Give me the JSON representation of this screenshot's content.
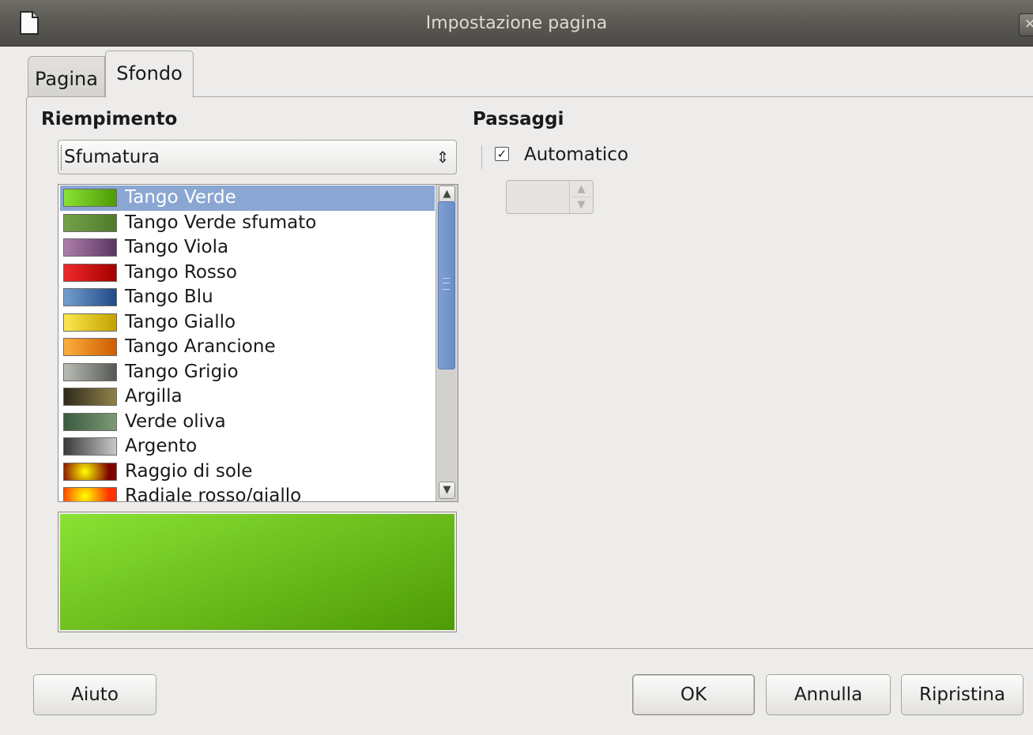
{
  "window": {
    "title": "Impostazione pagina",
    "close_glyph": "✕"
  },
  "tabs": [
    {
      "label": "Pagina",
      "active": false
    },
    {
      "label": "Sfondo",
      "active": true
    }
  ],
  "fill": {
    "heading": "Riempimento",
    "type_value": "Sfumatura",
    "gradients": [
      {
        "label": "Tango Verde",
        "colors": [
          "#8ae234",
          "#4e9a06"
        ],
        "selected": true
      },
      {
        "label": "Tango Verde sfumato",
        "colors": [
          "#73a24a",
          "#4e7b2a"
        ],
        "selected": false
      },
      {
        "label": "Tango Viola",
        "colors": [
          "#ad7fa8",
          "#5c3566"
        ],
        "selected": false
      },
      {
        "label": "Tango Rosso",
        "colors": [
          "#ef2929",
          "#a40000"
        ],
        "selected": false
      },
      {
        "label": "Tango Blu",
        "colors": [
          "#729fcf",
          "#204a87"
        ],
        "selected": false
      },
      {
        "label": "Tango Giallo",
        "colors": [
          "#fce94f",
          "#c4a000"
        ],
        "selected": false
      },
      {
        "label": "Tango Arancione",
        "colors": [
          "#fcaf3e",
          "#ce5c00"
        ],
        "selected": false
      },
      {
        "label": "Tango Grigio",
        "colors": [
          "#babdb6",
          "#555753"
        ],
        "selected": false
      },
      {
        "label": "Argilla",
        "colors": [
          "#2f2a1c",
          "#8f8348"
        ],
        "selected": false
      },
      {
        "label": "Verde oliva",
        "colors": [
          "#3b5a3f",
          "#7c9a74"
        ],
        "selected": false
      },
      {
        "label": "Argento",
        "colors": [
          "#3a3a3a",
          "#c8c8c8"
        ],
        "selected": false
      },
      {
        "label": "Raggio di sole",
        "colors": [
          "#ffff00",
          "#800000"
        ],
        "selected": false
      },
      {
        "label": "Radiale rosso/giallo",
        "colors": [
          "#ffff00",
          "#ff3300"
        ],
        "selected": false
      }
    ],
    "preview_colors": [
      "#8ae234",
      "#4e9a06"
    ]
  },
  "steps": {
    "heading": "Passaggi",
    "automatic_label": "Automatico",
    "automatic_checked": true,
    "check_glyph": "✓",
    "increment_value": ""
  },
  "buttons": {
    "help": "Aiuto",
    "ok": "OK",
    "cancel": "Annulla",
    "reset": "Ripristina"
  },
  "glyphs": {
    "dropdown_arrow": "⇕",
    "scroll_up": "▲",
    "scroll_down": "▼",
    "spin_up": "▲",
    "spin_down": "▼"
  }
}
